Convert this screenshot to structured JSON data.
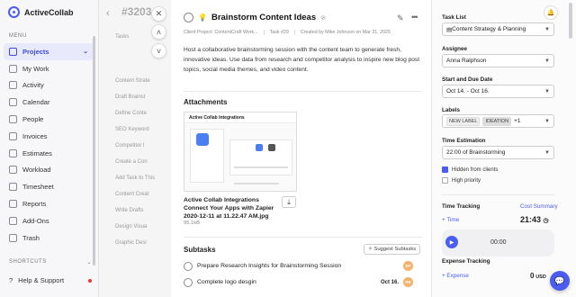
{
  "app": {
    "name": "ActiveCollab"
  },
  "sidebar": {
    "menu_label": "MENU",
    "items": [
      {
        "label": "Projects",
        "active": true
      },
      {
        "label": "My Work"
      },
      {
        "label": "Activity"
      },
      {
        "label": "Calendar"
      },
      {
        "label": "People"
      },
      {
        "label": "Invoices"
      },
      {
        "label": "Estimates"
      },
      {
        "label": "Workload"
      },
      {
        "label": "Timesheet"
      },
      {
        "label": "Reports"
      },
      {
        "label": "Add-Ons"
      },
      {
        "label": "Trash"
      }
    ],
    "shortcuts_label": "SHORTCUTS",
    "help_label": "Help & Support"
  },
  "background": {
    "title": "#3203",
    "tabs": "Tasks",
    "rows": [
      "Content Strate",
      "Draft Brainst",
      "Define Conte",
      "SEO Keyword",
      "Competitor l",
      "Create a Con",
      "Add Task to This",
      "Content Creat",
      "Write Drafts",
      "Design Visua",
      "Graphic Desi"
    ]
  },
  "task": {
    "title": "Brainstorm Content Ideas",
    "client_project": "Client Project: ContentCraft Work...",
    "task_number": "Task #29",
    "created_by": "Created by Mike Johnson on Mar 31, 2025",
    "description": "Host a collaborative brainstorming session with the content team to generate fresh, innovative ideas. Use data from research and competitor analysis to inspire new blog post topics, social media themes, and video content.",
    "attachments_heading": "Attachments",
    "attachment": {
      "thumb_title": "Active Collab Integrations",
      "name": "Active Collab Integrations Connect Your Apps with Zapier 2020-12-11 at 11.22.47 AM.jpg",
      "size": "95.1kB"
    },
    "subtasks_heading": "Subtasks",
    "suggest_label": "Suggest Subtasks",
    "subtasks": [
      {
        "label": "Prepare Research Insights for Brainstorming Session",
        "date": "",
        "avatar": "EP"
      },
      {
        "label": "Complete logo desgin",
        "date": "Oct 16.",
        "avatar": "RE"
      }
    ]
  },
  "details": {
    "task_list_label": "Task List",
    "task_list_value": "Content Strategy & Planning",
    "assignee_label": "Assignee",
    "assignee_value": "Anna Ralphson",
    "dates_label": "Start and Due Date",
    "dates_value": "Oct 14. - Oct 16.",
    "labels_label": "Labels",
    "labels": [
      "NEW LABEL",
      "IDEATION"
    ],
    "labels_more": "+1",
    "estimation_label": "Time Estimation",
    "estimation_value": "22:00 of Brainstorming",
    "hidden_from_clients": "Hidden from clients",
    "hidden_checked": true,
    "high_priority": "High priority",
    "high_priority_checked": false,
    "time_tracking_label": "Time Tracking",
    "cost_summary": "Cost Summary",
    "time_link": "+ Time",
    "time_total": "21:43",
    "timer": "00:00",
    "expense_tracking_label": "Expense Tracking",
    "expense_link": "+ Expense",
    "expense_total": "0",
    "expense_currency": "USD"
  },
  "colors": {
    "accent": "#4b5cf0",
    "sidebar_active_bg": "#e8eafc"
  }
}
